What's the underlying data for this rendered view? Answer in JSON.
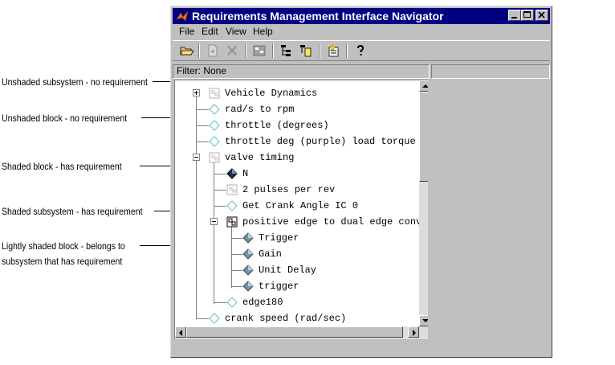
{
  "window": {
    "title": "Requirements Management Interface Navigator",
    "menu": [
      "File",
      "Edit",
      "View",
      "Help"
    ],
    "filter_text": "Filter: None"
  },
  "toolbar": {
    "buttons": [
      "open-folder-icon",
      "new-doc-icon",
      "delete-x-icon",
      "model-icon",
      "tree-collapse-icon",
      "tree-expand-icon",
      "add-requirement-icon",
      "help-question-icon"
    ]
  },
  "annotations": [
    "Unshaded subsystem - no requirement",
    "Unshaded block - no requirement",
    "Shaded block - has requirement",
    "Shaded subsystem - has requirement",
    "Lightly shaded block - belongs to",
    "subsystem that has requirement"
  ],
  "tree": [
    {
      "label": "Vehicle Dynamics",
      "icon": "subsystem-unshaded-icon"
    },
    {
      "label": "rad/s to rpm",
      "icon": "block-unshaded-icon"
    },
    {
      "label": "throttle (degrees)",
      "icon": "block-unshaded-icon"
    },
    {
      "label": "throttle deg (purple) load torque l",
      "icon": "block-unshaded-icon"
    },
    {
      "label": "valve timing",
      "icon": "subsystem-unshaded-icon"
    },
    {
      "label": "N",
      "icon": "block-shaded-icon"
    },
    {
      "label": "2 pulses per rev",
      "icon": "subsystem-unshaded-icon"
    },
    {
      "label": "Get Crank Angle IC 0",
      "icon": "block-unshaded-icon"
    },
    {
      "label": "positive edge to dual edge conve",
      "icon": "subsystem-shaded-icon"
    },
    {
      "label": "Trigger",
      "icon": "block-light-shaded-icon"
    },
    {
      "label": "Gain",
      "icon": "block-light-shaded-icon"
    },
    {
      "label": "Unit Delay",
      "icon": "block-light-shaded-icon"
    },
    {
      "label": "trigger",
      "icon": "block-light-shaded-icon"
    },
    {
      "label": "edge180",
      "icon": "block-unshaded-icon"
    },
    {
      "label": "crank speed (rad/sec)",
      "icon": "block-unshaded-icon"
    }
  ]
}
